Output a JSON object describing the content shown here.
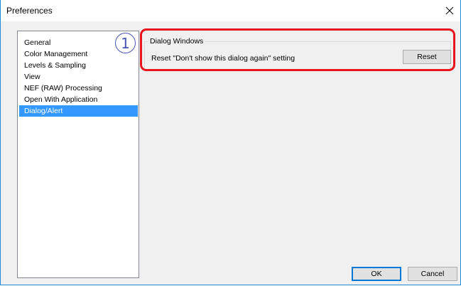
{
  "window": {
    "title": "Preferences",
    "close_icon": "close-icon"
  },
  "sidebar": {
    "items": [
      {
        "label": "General",
        "selected": false
      },
      {
        "label": "Color Management",
        "selected": false
      },
      {
        "label": "Levels & Sampling",
        "selected": false
      },
      {
        "label": "View",
        "selected": false
      },
      {
        "label": "NEF (RAW) Processing",
        "selected": false
      },
      {
        "label": "Open With Application",
        "selected": false
      },
      {
        "label": "Dialog/Alert",
        "selected": true
      }
    ]
  },
  "main": {
    "group_title": "Dialog Windows",
    "reset_label": "Reset \"Don't show this dialog again\" setting",
    "reset_button": "Reset"
  },
  "footer": {
    "ok_button": "OK",
    "cancel_button": "Cancel"
  },
  "annotation": {
    "callout_number": "1",
    "highlight_color": "#e8141e",
    "callout_color": "#4a55b5"
  },
  "colors": {
    "selection": "#3399ff",
    "window_border": "#1e8bd6"
  }
}
